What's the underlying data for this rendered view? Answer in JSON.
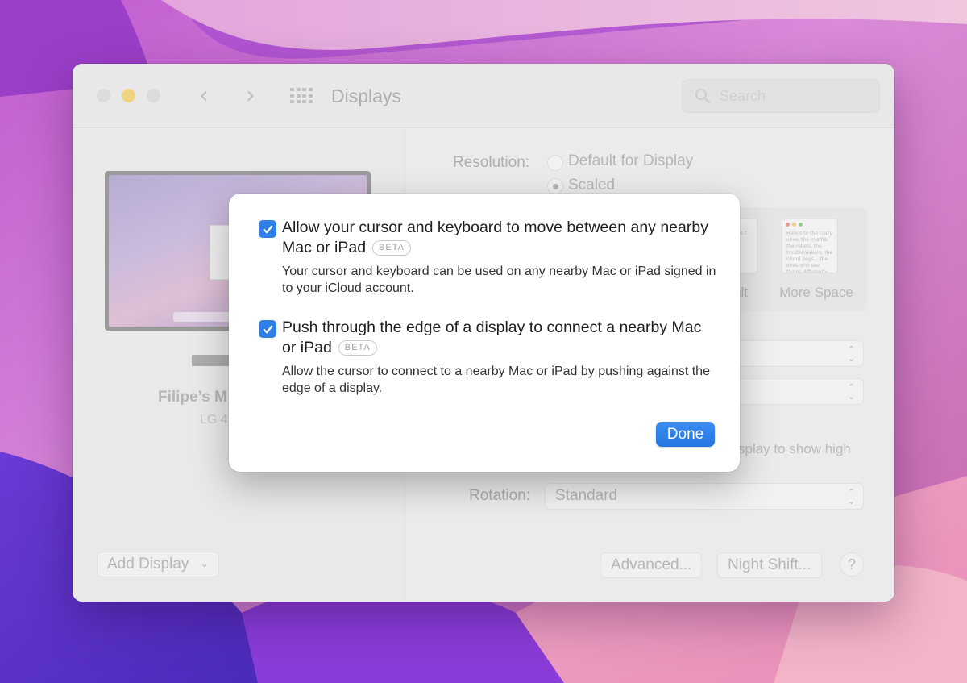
{
  "window": {
    "title": "Displays",
    "search_placeholder": "Search",
    "nav_back": "‹",
    "nav_forward": "›"
  },
  "left_pane": {
    "display_name": "Filipe’s M",
    "display_model": "LG 4",
    "add_display_label": "Add Display"
  },
  "right_pane": {
    "resolution_label": "Resolution:",
    "resolution_options": [
      "Default for Display",
      "Scaled"
    ],
    "selected_resolution": "Scaled",
    "preview_default_label": "ult",
    "preview_more_space_label": "More Space",
    "preview_more_space_text": "Here’s to the crazy ones, the misfits, the rebels, the troublemakers, the round pegs... the ones who see things differently. They’re not fond of rules. And they have no respect for the status quo. You can quote them, disagree with them... Because they change things.",
    "preview_default_text": "the cr kers. see t they",
    "hidden_text": "splay to show high",
    "rotation_label": "Rotation:",
    "rotation_value": "Standard",
    "advanced_label": "Advanced...",
    "night_shift_label": "Night Shift...",
    "help_label": "?"
  },
  "dialog": {
    "option1_title": "Allow your cursor and keyboard to move between any nearby Mac or iPad",
    "option1_checked": true,
    "option1_badge": "BETA",
    "option1_description": "Your cursor and keyboard can be used on any nearby Mac or iPad signed in to your iCloud account.",
    "option2_title": "Push through the edge of a display to connect a nearby Mac or iPad",
    "option2_checked": true,
    "option2_badge": "BETA",
    "option2_description": "Allow the cursor to connect to a nearby Mac or iPad by pushing against the edge of a display.",
    "done_label": "Done"
  },
  "colors": {
    "accent": "#2f7fe6",
    "minimize_button": "#f4c84a"
  }
}
